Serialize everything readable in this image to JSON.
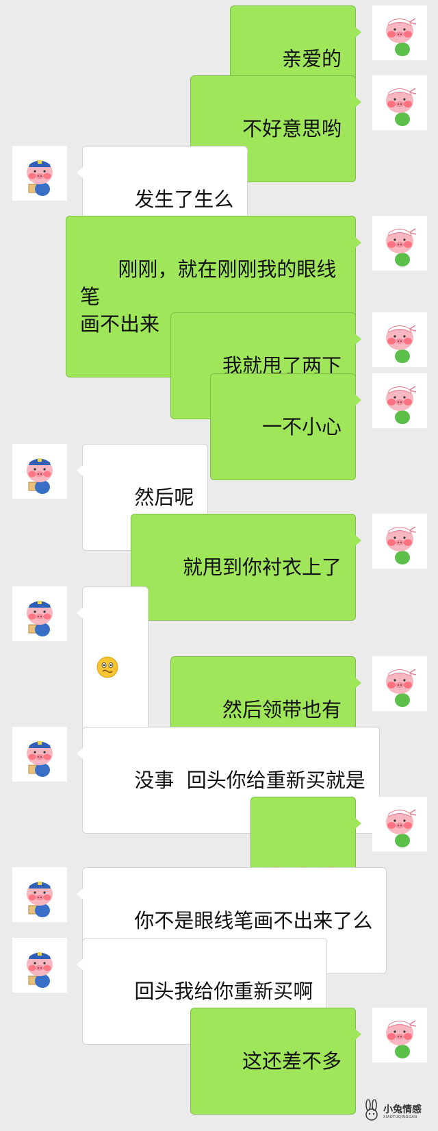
{
  "chat": {
    "messages": [
      {
        "sender": "me",
        "text": "亲爱的"
      },
      {
        "sender": "me",
        "text": "不好意思哟"
      },
      {
        "sender": "other",
        "text": "发生了生么"
      },
      {
        "sender": "me",
        "text": "刚刚，就在刚刚我的眼线笔\n画不出来"
      },
      {
        "sender": "me",
        "text": "我就甩了两下"
      },
      {
        "sender": "me",
        "text": "一不小心"
      },
      {
        "sender": "other",
        "text": "然后呢"
      },
      {
        "sender": "me",
        "text": "就甩到你衬衣上了"
      },
      {
        "sender": "other",
        "emoji": [
          "awkward-face-emoji"
        ]
      },
      {
        "sender": "me",
        "text": "然后领带也有"
      },
      {
        "sender": "other",
        "text": "没事  回头你给重新买就是"
      },
      {
        "sender": "me",
        "emoji": [
          "surprised-face-emoji",
          "surprised-face-emoji",
          "surprised-face-emoji"
        ]
      },
      {
        "sender": "other",
        "text": "你不是眼线笔画不出来了么"
      },
      {
        "sender": "other",
        "text": "回头我给你重新买啊"
      },
      {
        "sender": "me",
        "text": "这还差不多"
      }
    ]
  },
  "avatars": {
    "me": "pig-headband-avatar-icon",
    "other": "pig-mailman-avatar-icon"
  },
  "colors": {
    "background": "#ebebeb",
    "my_bubble": "#9fe65b",
    "other_bubble": "#ffffff"
  },
  "watermark": {
    "text": "小兔情感",
    "subtext": "XIAOTUQINGGAN",
    "icon": "rabbit-logo-icon"
  }
}
